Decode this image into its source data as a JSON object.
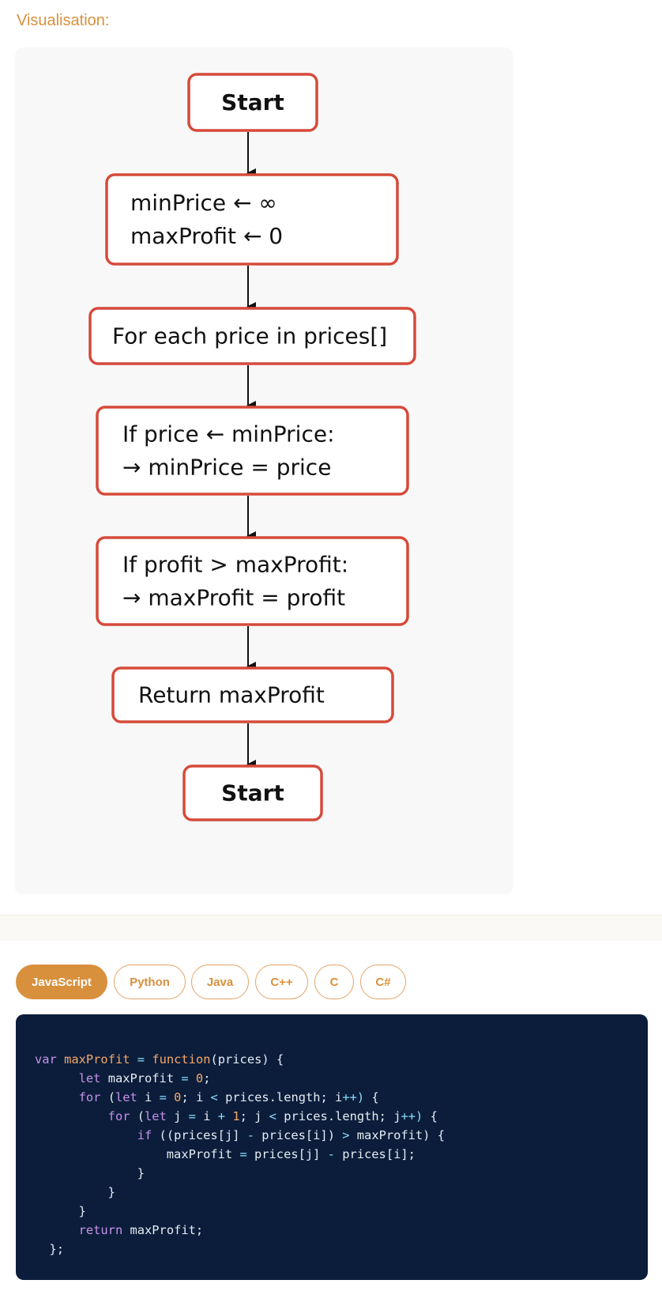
{
  "section_label": "Visualisation:",
  "flowchart": {
    "nodes": [
      {
        "id": "start",
        "lines": [
          "Start"
        ],
        "bold": true
      },
      {
        "id": "init",
        "lines": [
          "minPrice ← ∞",
          "maxProfit ← 0"
        ]
      },
      {
        "id": "loop",
        "lines": [
          "For each price in prices[]"
        ]
      },
      {
        "id": "check-min",
        "lines": [
          "If price ← minPrice:",
          "→ minPrice = price"
        ]
      },
      {
        "id": "check-profit",
        "lines": [
          "If profit > maxProfit:",
          "→ maxProfit = profit"
        ]
      },
      {
        "id": "return",
        "lines": [
          "Return maxProfit"
        ]
      },
      {
        "id": "end",
        "lines": [
          "Start"
        ],
        "bold": true
      }
    ]
  },
  "tabs": [
    "JavaScript",
    "Python",
    "Java",
    "C++",
    "C",
    "C#"
  ],
  "active_tab": "JavaScript",
  "code": {
    "language": "JavaScript",
    "lines": [
      "var maxProfit = function(prices) {",
      "      let maxProfit = 0;",
      "      for (let i = 0; i < prices.length; i++) {",
      "          for (let j = i + 1; j < prices.length; j++) {",
      "              if ((prices[j] - prices[i]) > maxProfit) {",
      "                  maxProfit = prices[j] - prices[i];",
      "              }",
      "          }",
      "      }",
      "      return maxProfit;",
      "  };"
    ]
  },
  "colors": {
    "accent": "#d9903d",
    "node_border": "#d64a3a",
    "code_bg": "#0b1d3a"
  }
}
